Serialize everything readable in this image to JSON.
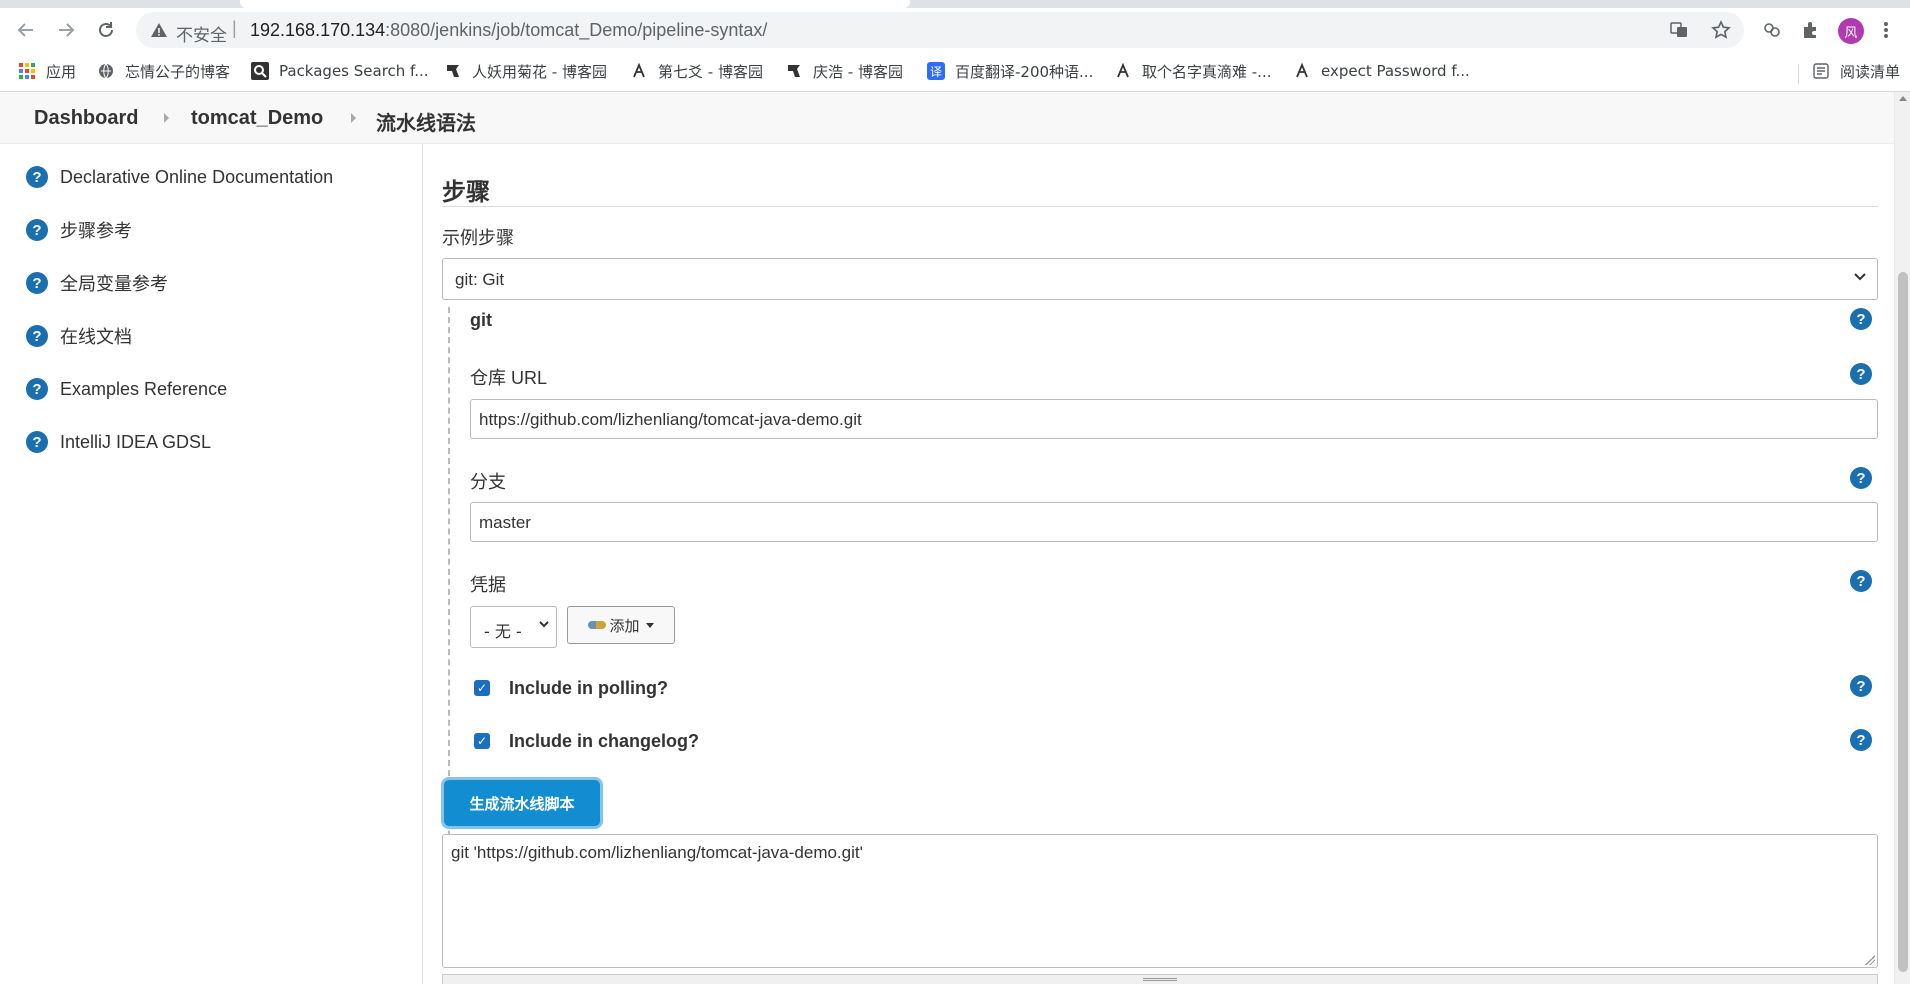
{
  "browser": {
    "security_label": "不安全",
    "url_host": "192.168.170.134",
    "url_rest": ":8080/jenkins/job/tomcat_Demo/pipeline-syntax/",
    "avatar_initial": "风",
    "bookmarks": [
      {
        "label": "应用",
        "icon": "apps-grid-icon"
      },
      {
        "label": "忘情公子的博客",
        "icon": "globe-icon"
      },
      {
        "label": "Packages Search f...",
        "icon": "search-icon"
      },
      {
        "label": "人妖用菊花 - 博客园",
        "icon": "blog-icon"
      },
      {
        "label": "第七爻 - 博客园",
        "icon": "blog-icon"
      },
      {
        "label": "庆浩 - 博客园",
        "icon": "blog-icon"
      },
      {
        "label": "百度翻译-200种语...",
        "icon": "translate-icon"
      },
      {
        "label": "取个名字真滴难 -...",
        "icon": "blog-icon"
      },
      {
        "label": "expect Password f...",
        "icon": "blog-icon"
      }
    ],
    "reading_list_label": "阅读清单"
  },
  "breadcrumb": {
    "items": [
      "Dashboard",
      "tomcat_Demo",
      "流水线语法"
    ]
  },
  "sidebar": {
    "items": [
      {
        "label": "Declarative Online Documentation"
      },
      {
        "label": "步骤参考"
      },
      {
        "label": "全局变量参考"
      },
      {
        "label": "在线文档"
      },
      {
        "label": "Examples Reference"
      },
      {
        "label": "IntelliJ IDEA GDSL"
      }
    ]
  },
  "main": {
    "section_title": "步骤",
    "sample_step_label": "示例步骤",
    "sample_step_value": "git: Git",
    "step_name": "git",
    "repo_url_label": "仓库 URL",
    "repo_url_value": "https://github.com/lizhenliang/tomcat-java-demo.git",
    "branch_label": "分支",
    "branch_value": "master",
    "credentials_label": "凭据",
    "credentials_value": "- 无 -",
    "add_button_label": "添加",
    "polling_label": "Include in polling?",
    "polling_checked": true,
    "changelog_label": "Include in changelog?",
    "changelog_checked": true,
    "generate_button_label": "生成流水线脚本",
    "output_script": "git 'https://github.com/lizhenliang/tomcat-java-demo.git'"
  },
  "colors": {
    "accent": "#138dd2",
    "help_icon": "#1a6fb0",
    "checkbox": "#1a6fc0"
  }
}
